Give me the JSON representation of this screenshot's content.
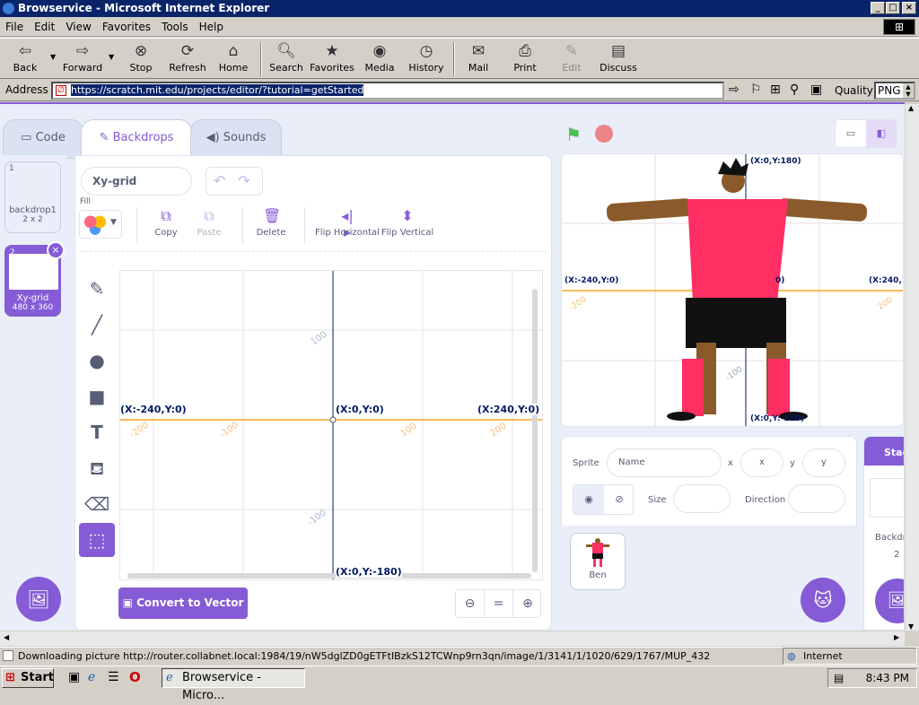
{
  "window": {
    "title": "Browservice - Microsoft Internet Explorer"
  },
  "menu": [
    "File",
    "Edit",
    "View",
    "Favorites",
    "Tools",
    "Help"
  ],
  "toolbar": {
    "back": "Back",
    "forward": "Forward",
    "stop": "Stop",
    "refresh": "Refresh",
    "home": "Home",
    "search": "Search",
    "favorites": "Favorites",
    "media": "Media",
    "history": "History",
    "mail": "Mail",
    "print": "Print",
    "edit": "Edit",
    "discuss": "Discuss"
  },
  "address": {
    "label": "Address",
    "url": "https://scratch.mit.edu/projects/editor/?tutorial=getStarted",
    "quality_label": "Quality",
    "quality_value": "PNG"
  },
  "scratch": {
    "tabs": [
      "Code",
      "Backdrops",
      "Sounds"
    ],
    "backdrops": [
      {
        "num": "1",
        "name": "backdrop1",
        "size": "2 x 2"
      },
      {
        "num": "2",
        "name": "Xy-grid",
        "size": "480 x 360"
      }
    ],
    "costume_name": "Xy-grid",
    "fill_label": "Fill",
    "edit_buttons": {
      "copy": "Copy",
      "paste": "Paste",
      "delete": "Delete",
      "flip_h": "Flip Horizontal",
      "flip_v": "Flip Vertical"
    },
    "canvas_labels": {
      "left": "(X:-240,Y:0)",
      "center": "(X:0,Y:0)",
      "right": "(X:240,Y:0)",
      "bottom": "(X:0,Y:-180)",
      "n100": "100",
      "nm100": "-100",
      "n200": "200",
      "nm200": "-200"
    },
    "convert_button": "Convert to Vector",
    "zoom_equal": "=",
    "stage_labels": {
      "top": "(X:0,Y:180)",
      "left": "(X:-240,Y:0)",
      "center": "0)",
      "right": "(X:240,",
      "bottom": "(X:0,Y:-180)",
      "n100": "100",
      "nm100": "-100",
      "n200": "200",
      "nm200": "-200"
    },
    "sprite_info": {
      "sprite_label": "Sprite",
      "name_placeholder": "Name",
      "x_label": "x",
      "x_placeholder": "x",
      "y_label": "y",
      "y_placeholder": "y",
      "size_label": "Size",
      "direction_label": "Direction"
    },
    "sprites": [
      {
        "name": "Ben"
      }
    ],
    "stage_col": {
      "title": "Stag",
      "backdrops_label": "Backdr",
      "backdrops_count": "2"
    }
  },
  "status": {
    "text": "Downloading picture http://router.collabnet.local:1984/19/nW5dglZD0gETFtIBzkS12TCWnp9rn3qn/image/1/3141/1/1020/629/1767/MUP_432",
    "zone": "Internet"
  },
  "taskbar": {
    "start": "Start",
    "task": "Browservice - Micro...",
    "time": "8:43 PM"
  },
  "colors": {
    "accent": "#855cd6",
    "axis": "#f5a623",
    "title_bar": "#0a246a"
  }
}
